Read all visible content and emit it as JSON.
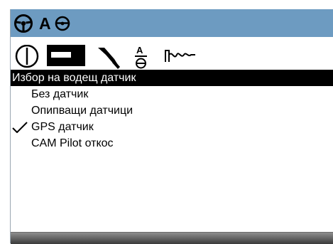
{
  "titlebar": {
    "icons": [
      "steering-wheel-icon",
      "auto-steer-icon"
    ],
    "auto_steer_text": "A"
  },
  "toolbar": {
    "tabs": [
      "on-off-icon",
      "implement-bar-icon",
      "tool-icon",
      "auto-steer-settings-icon",
      "signal-graph-icon"
    ],
    "auto_steer_letter": "A"
  },
  "menu": {
    "title": "Избор на водещ датчик",
    "items": [
      {
        "label": "Без датчик",
        "checked": false
      },
      {
        "label": "Опипващи датчици",
        "checked": false
      },
      {
        "label": "GPS датчик",
        "checked": true
      },
      {
        "label": "CAM Pilot откос",
        "checked": false
      }
    ]
  },
  "colors": {
    "titlebar": "#6d9bc1",
    "menu_title_bg": "#000000",
    "menu_title_fg": "#ffffff"
  }
}
